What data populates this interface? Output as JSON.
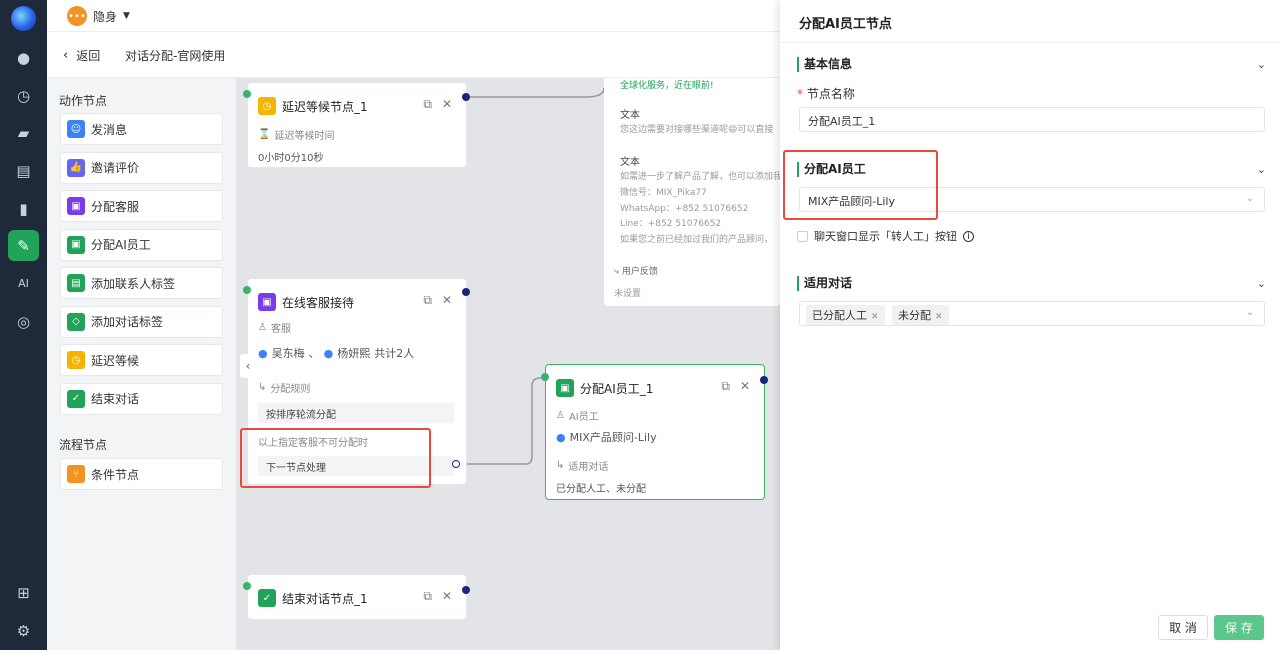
{
  "rail": {
    "items": [
      "chat-icon",
      "history-icon",
      "monitor-icon",
      "contact-card-icon",
      "chart-icon",
      "flow-icon",
      "ai-icon",
      "target-icon"
    ],
    "bottom": [
      "apps-icon",
      "settings-icon"
    ]
  },
  "topbar": {
    "status": "隐身",
    "caret": "▼"
  },
  "subbar": {
    "back": "返回",
    "title": "对话分配-官网使用"
  },
  "palette": {
    "action_title": "动作节点",
    "actions": [
      "发消息",
      "邀请评价",
      "分配客服",
      "分配AI员工",
      "添加联系人标签",
      "添加对话标签",
      "延迟等候",
      "结束对话"
    ],
    "flow_title": "流程节点",
    "flows": [
      "条件节点"
    ],
    "colors": [
      "#3b82f6",
      "#6366f1",
      "#7c3aed",
      "#22a35a",
      "#22a35a",
      "#22a35a",
      "#f5b400",
      "#22a35a"
    ]
  },
  "canvas": {
    "delay_node": {
      "title": "延迟等候节点_1",
      "label": "延迟等候时间",
      "value": "0小时0分10秒"
    },
    "service_node": {
      "title": "在线客服接待",
      "agents_label": "客服",
      "agent1": "吴东梅",
      "sep": "、",
      "agent2": "杨妍熙",
      "count": "共计2人",
      "rule_label": "分配规则",
      "rule": "按排序轮流分配",
      "fallback_label": "以上指定客服不可分配时",
      "fallback": "下一节点处理"
    },
    "ai_node": {
      "title": "分配AI员工_1",
      "ai_label": "AI员工",
      "ai": "MIX产品顾问-Lily",
      "dialog_label": "适用对话",
      "dialog": "已分配人工、未分配"
    },
    "end_node": {
      "title": "结束对话节点_1"
    },
    "msg": {
      "top": "全球化服务，近在眼前!",
      "t1": "文本",
      "p1": "您这边需要对接哪些渠道呢😄可以直接",
      "t2": "文本",
      "p2_lines": [
        "如需进一步了解产品了解，也可以添加我",
        "微信号：MIX_Pika77",
        "WhatsApp：+852 51076652",
        "Line：+852 51076652",
        "如果您之前已经加过我们的产品顾问，"
      ],
      "feedback": "用户反馈",
      "unset": "未设置"
    }
  },
  "panel": {
    "title": "分配AI员工节点",
    "basic": "基本信息",
    "name_req": "*",
    "name_label": "节点名称",
    "name_value": "分配AI员工_1",
    "ai_section": "分配AI员工",
    "ai_value": "MIX产品顾问-Lily",
    "checkbox_label": "聊天窗口显示「转人工」按钮",
    "dialog_section": "适用对话",
    "tags": [
      "已分配人工",
      "未分配"
    ],
    "cancel": "取 消",
    "save": "保 存"
  }
}
